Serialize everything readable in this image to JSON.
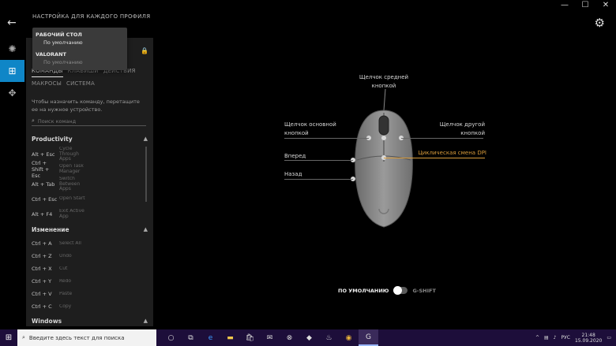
{
  "profile_title": "НАСТРОЙКА ДЛЯ КАЖДОГО ПРОФИЛЯ",
  "dropdown": {
    "groups": [
      {
        "title": "РАБОЧИЙ СТОЛ",
        "item": "По умолчанию"
      },
      {
        "title": "VALORANT",
        "item": "По умолчанию"
      }
    ]
  },
  "tabs": {
    "row1": [
      "КОМАНДЫ",
      "КЛАВИШИ",
      "ДЕЙСТВИЯ"
    ],
    "row2": [
      "МАКРОСЫ",
      "СИСТЕМА"
    ]
  },
  "hint": "Чтобы назначить команду, перетащите ее на нужное устройство.",
  "search_placeholder": "Поиск команд",
  "sections": [
    {
      "title": "Productivity",
      "rows": [
        {
          "key": "Alt + Esc",
          "action": "Cycle Through Apps"
        },
        {
          "key": "Ctrl + Shift + Esc",
          "action": "Open Task Manager"
        },
        {
          "key": "Alt + Tab",
          "action": "Switch Between Apps"
        },
        {
          "key": "Ctrl + Esc",
          "action": "Open Start"
        },
        {
          "key": "Alt + F4",
          "action": "Exit Active App"
        }
      ]
    },
    {
      "title": "Изменение",
      "rows": [
        {
          "key": "Ctrl + A",
          "action": "Select All"
        },
        {
          "key": "Ctrl + Z",
          "action": "Undo"
        },
        {
          "key": "Ctrl + X",
          "action": "Cut"
        },
        {
          "key": "Ctrl + Y",
          "action": "Redo"
        },
        {
          "key": "Ctrl + V",
          "action": "Paste"
        },
        {
          "key": "Ctrl + C",
          "action": "Copy"
        }
      ]
    },
    {
      "title": "Windows",
      "rows": []
    }
  ],
  "callouts": {
    "middle": "Щелчок средней кнопкой",
    "primary": "Щелчок основной кнопкой",
    "secondary": "Щелчок другой кнопкой",
    "dpi": "Циклическая смена DPI",
    "forward": "Вперед",
    "back": "Назад"
  },
  "toggle": {
    "left": "ПО УМОЛЧАНИЮ",
    "right": "G-SHIFT"
  },
  "taskbar": {
    "search_placeholder": "Введите здесь текст для поиска",
    "lang": "РУС",
    "time": "21:48",
    "date": "15.09.2020"
  },
  "colors": {
    "accent": "#0f86c7",
    "highlight": "#d79a3a",
    "taskbar": "#1d0e3a"
  }
}
